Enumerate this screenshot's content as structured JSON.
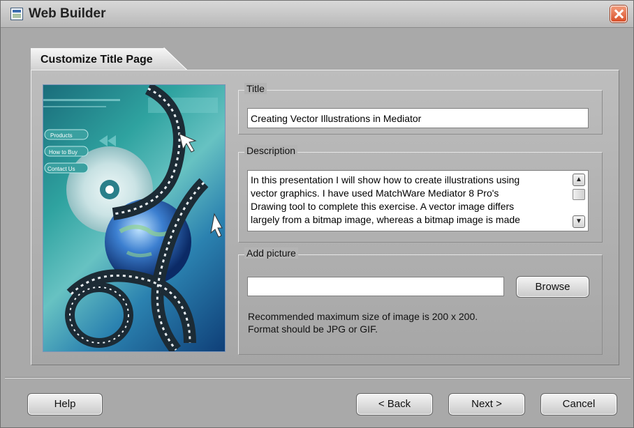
{
  "window": {
    "title": "Web Builder"
  },
  "tab": {
    "label": "Customize Title Page"
  },
  "preview_image": {
    "menu_items": [
      "Products",
      "How to Buy",
      "Contact Us"
    ]
  },
  "title_group": {
    "label": "Title",
    "value": "Creating Vector Illustrations in Mediator"
  },
  "description_group": {
    "label": "Description",
    "lines": [
      "In this presentation I will show how to create illustrations using",
      "vector graphics. I have used MatchWare Mediator 8 Pro's",
      "Drawing tool to complete this exercise. A vector image differs",
      "largely from a bitmap image, whereas a bitmap image is made"
    ]
  },
  "picture_group": {
    "label": "Add picture",
    "path_value": "",
    "browse_label": "Browse",
    "hint_line1": "Recommended maximum size of image is 200 x 200.",
    "hint_line2": "Format should be JPG or GIF."
  },
  "buttons": {
    "help": "Help",
    "back": "< Back",
    "next": "Next >",
    "cancel": "Cancel"
  },
  "icons": {
    "app": "web-builder-app-icon",
    "close": "close-icon",
    "scroll_up": "scroll-up-arrow-icon",
    "scroll_down": "scroll-down-arrow-icon"
  },
  "colors": {
    "close_button": "#d9502a",
    "dialog_bg": "#a9a9a9"
  }
}
